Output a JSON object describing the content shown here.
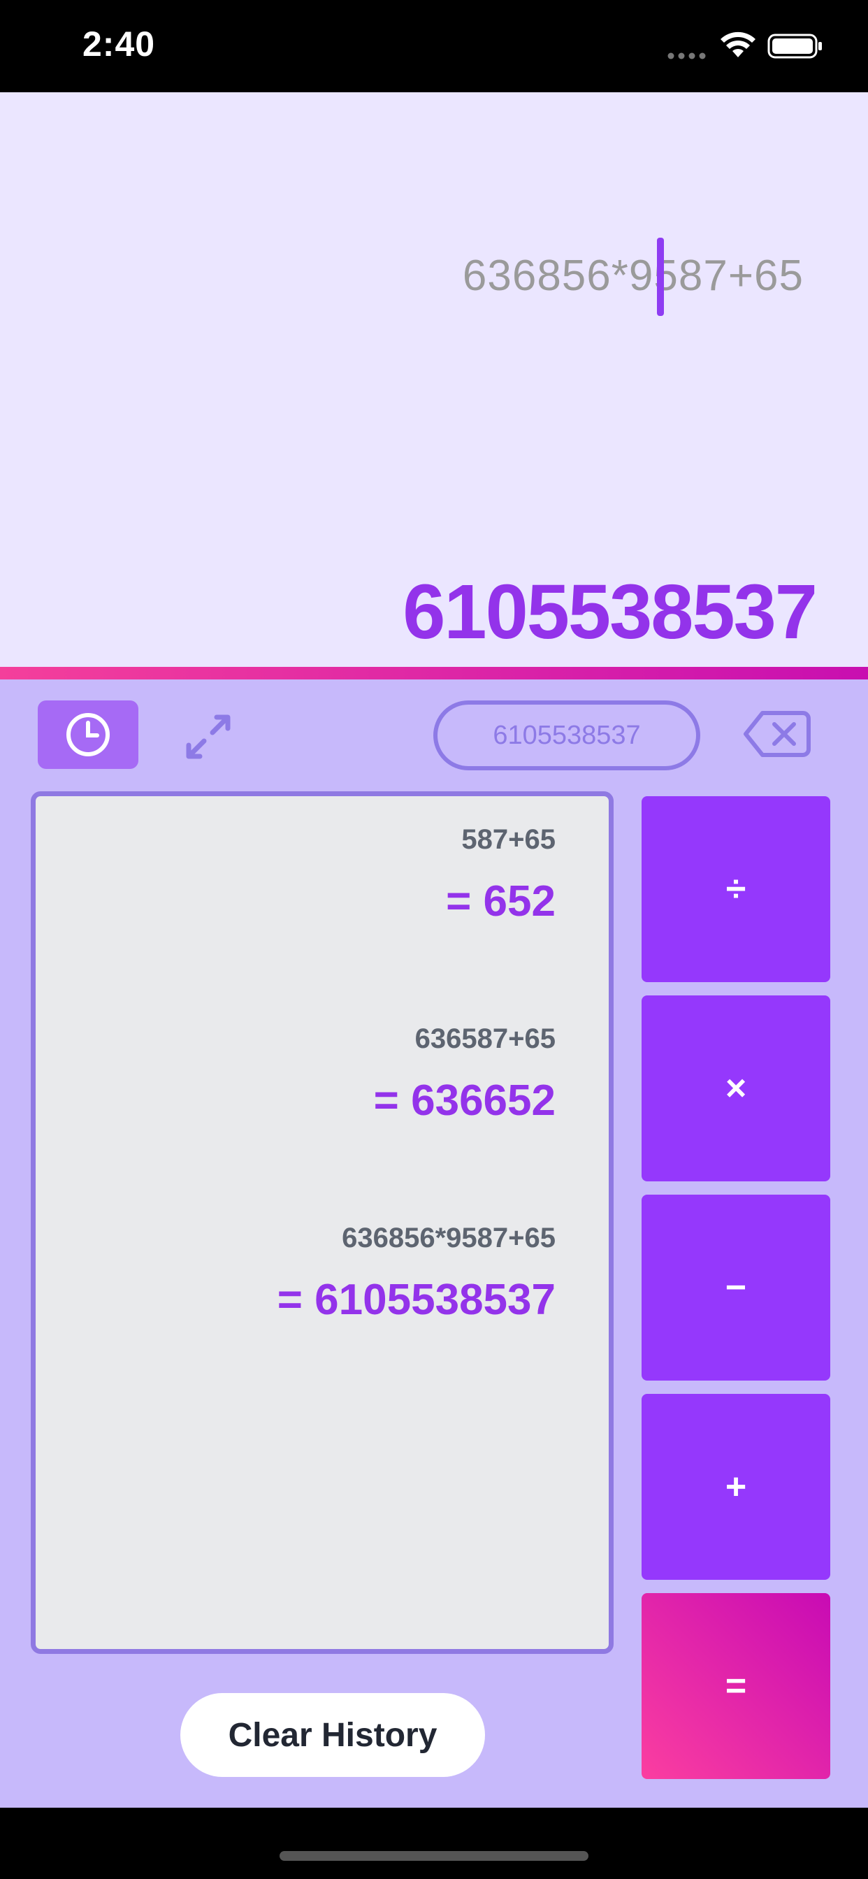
{
  "status_bar": {
    "time": "2:40"
  },
  "display": {
    "expression": "636856*9587+65",
    "result": "6105538537"
  },
  "toolbar": {
    "result_pill": "6105538537"
  },
  "history": [
    {
      "expression": "587+65",
      "result": "= 652"
    },
    {
      "expression": "636587+65",
      "result": "= 636652"
    },
    {
      "expression": "636856*9587+65",
      "result": "= 6105538537"
    }
  ],
  "clear_history_label": "Clear History",
  "operators": {
    "divide": "÷",
    "multiply": "×",
    "subtract": "−",
    "add": "+",
    "equals": "="
  },
  "colors": {
    "accent": "#9538fc",
    "display_bg": "#ebe6ff",
    "keypad_bg": "#c7b9fb",
    "equals_gradient_start": "#fb3ea0",
    "equals_gradient_end": "#c80bb4"
  }
}
